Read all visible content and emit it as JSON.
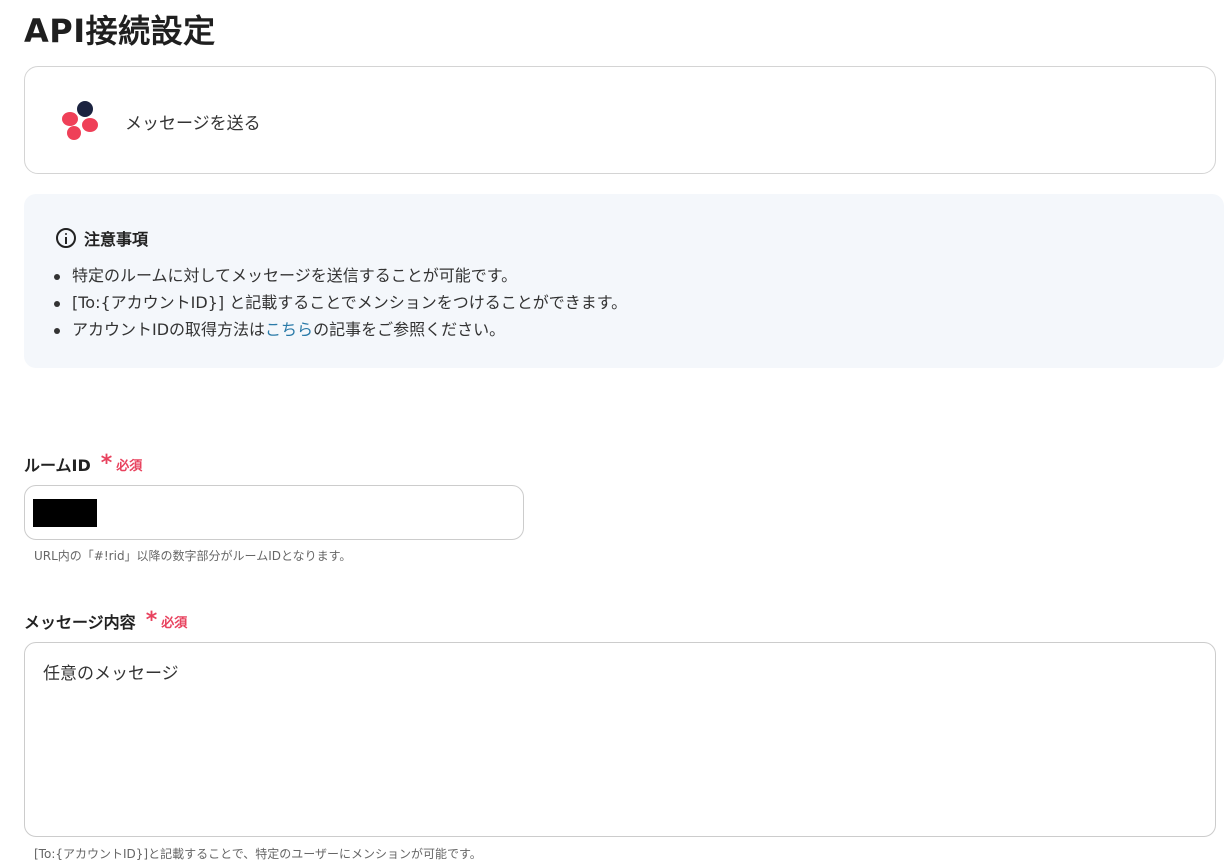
{
  "page": {
    "title": "API接続設定"
  },
  "action": {
    "label": "メッセージを送る",
    "logo_icon": "chatwork-logo-icon"
  },
  "notice": {
    "title": "注意事項",
    "items": [
      {
        "text": "特定のルームに対してメッセージを送信することが可能です。"
      },
      {
        "text": "[To:{アカウントID}] と記載することでメンションをつけることができます。"
      },
      {
        "before": "アカウントIDの取得方法は",
        "link": "こちら",
        "after": "の記事をご参照ください。"
      }
    ]
  },
  "fields": {
    "room": {
      "label": "ルームID",
      "required": "必須",
      "value": "",
      "hint": "URL内の「#!rid」以降の数字部分がルームIDとなります。"
    },
    "message": {
      "label": "メッセージ内容",
      "required": "必須",
      "value": "任意のメッセージ",
      "hint": "[To:{アカウントID}]と記載することで、特定のユーザーにメンションが可能です。"
    }
  },
  "colors": {
    "required": "#e8425e",
    "link": "#2a7aa8",
    "notice_bg": "#f4f7fb",
    "logo_red": "#ef4058",
    "logo_navy": "#1c2340"
  }
}
